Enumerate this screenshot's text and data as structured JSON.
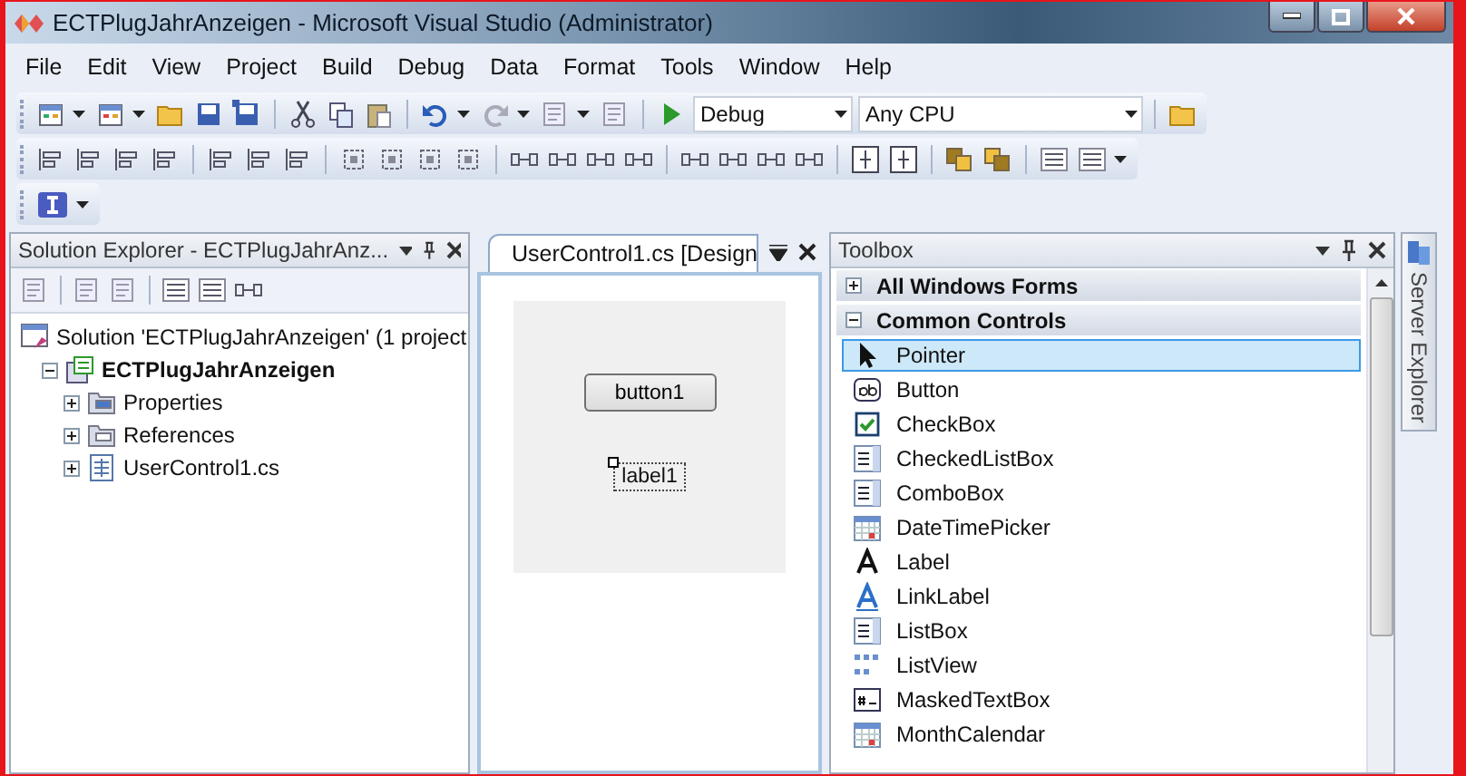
{
  "window": {
    "title": "ECTPlugJahrAnzeigen - Microsoft Visual Studio (Administrator)"
  },
  "menu": [
    "File",
    "Edit",
    "View",
    "Project",
    "Build",
    "Debug",
    "Data",
    "Format",
    "Tools",
    "Window",
    "Help"
  ],
  "toolbar": {
    "configuration": "Debug",
    "platform": "Any CPU"
  },
  "solution_explorer": {
    "title": "Solution Explorer - ECTPlugJahrAnz...",
    "tree": [
      {
        "label": "Solution 'ECTPlugJahrAnzeigen' (1 project",
        "kind": "solution",
        "children": [
          {
            "label": "ECTPlugJahrAnzeigen",
            "kind": "project",
            "expanded": true,
            "children": [
              {
                "label": "Properties",
                "kind": "properties",
                "expanded": false
              },
              {
                "label": "References",
                "kind": "references",
                "expanded": false
              },
              {
                "label": "UserControl1.cs",
                "kind": "file",
                "expanded": false
              }
            ]
          }
        ]
      }
    ]
  },
  "designer": {
    "tab": "UserControl1.cs [Design",
    "button": "button1",
    "label": "label1"
  },
  "toolbox": {
    "title": "Toolbox",
    "groups": [
      {
        "label": "All Windows Forms",
        "expanded": false
      },
      {
        "label": "Common Controls",
        "expanded": true,
        "items": [
          {
            "label": "Pointer",
            "kind": "pointer",
            "selected": true
          },
          {
            "label": "Button",
            "kind": "button",
            "selected": false
          },
          {
            "label": "CheckBox",
            "kind": "checkbox",
            "selected": false
          },
          {
            "label": "CheckedListBox",
            "kind": "checkedlistbox",
            "selected": false
          },
          {
            "label": "ComboBox",
            "kind": "combobox",
            "selected": false
          },
          {
            "label": "DateTimePicker",
            "kind": "datetimepicker",
            "selected": false
          },
          {
            "label": "Label",
            "kind": "label",
            "selected": false
          },
          {
            "label": "LinkLabel",
            "kind": "linklabel",
            "selected": false
          },
          {
            "label": "ListBox",
            "kind": "listbox",
            "selected": false
          },
          {
            "label": "ListView",
            "kind": "listview",
            "selected": false
          },
          {
            "label": "MaskedTextBox",
            "kind": "maskedtextbox",
            "selected": false
          },
          {
            "label": "MonthCalendar",
            "kind": "monthcalendar",
            "selected": false
          }
        ]
      }
    ]
  },
  "side_tab": {
    "label": "Server Explorer"
  }
}
